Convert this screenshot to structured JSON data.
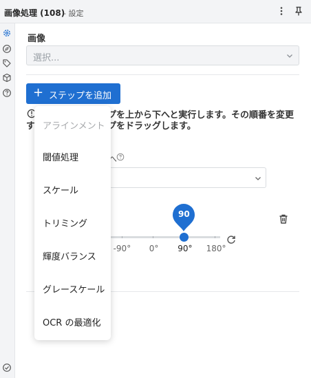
{
  "header": {
    "title": "画像処理 (108)",
    "subtitle": "- 設定",
    "icons": [
      "more-vertical-icon",
      "pin-icon"
    ]
  },
  "rail": {
    "icons": [
      "gear-icon",
      "compass-icon",
      "tag-icon",
      "cube-icon",
      "help-icon",
      "check-circle-icon"
    ]
  },
  "image_section": {
    "label": "画像",
    "select_placeholder": "選択..."
  },
  "add_step_button": {
    "icon": "+",
    "label": "ステップを追加"
  },
  "description": {
    "line1_part": "プを上から下へと実行します。その順番を変更",
    "line2_prefix": "す",
    "line2_part": "プをドラッグします。"
  },
  "step": {
    "partial_label": "へ"
  },
  "rotation_slider": {
    "value": 90,
    "bubble_label": "90",
    "tick_labels": [
      "-90°",
      "0°",
      "90°",
      "180°"
    ],
    "selected_label": "90°",
    "min": -180,
    "max": 180
  },
  "menu": {
    "items": [
      {
        "label": "アラインメント",
        "disabled": true
      },
      {
        "label": "閾値処理",
        "disabled": false
      },
      {
        "label": "スケール",
        "disabled": false
      },
      {
        "label": "トリミング",
        "disabled": false
      },
      {
        "label": "輝度バランス",
        "disabled": false
      },
      {
        "label": "グレースケール",
        "disabled": false
      },
      {
        "label": "OCR の最適化",
        "disabled": false
      }
    ]
  },
  "colors": {
    "accent": "#1f6fd1",
    "panel_bg": "#f3f4f6"
  }
}
